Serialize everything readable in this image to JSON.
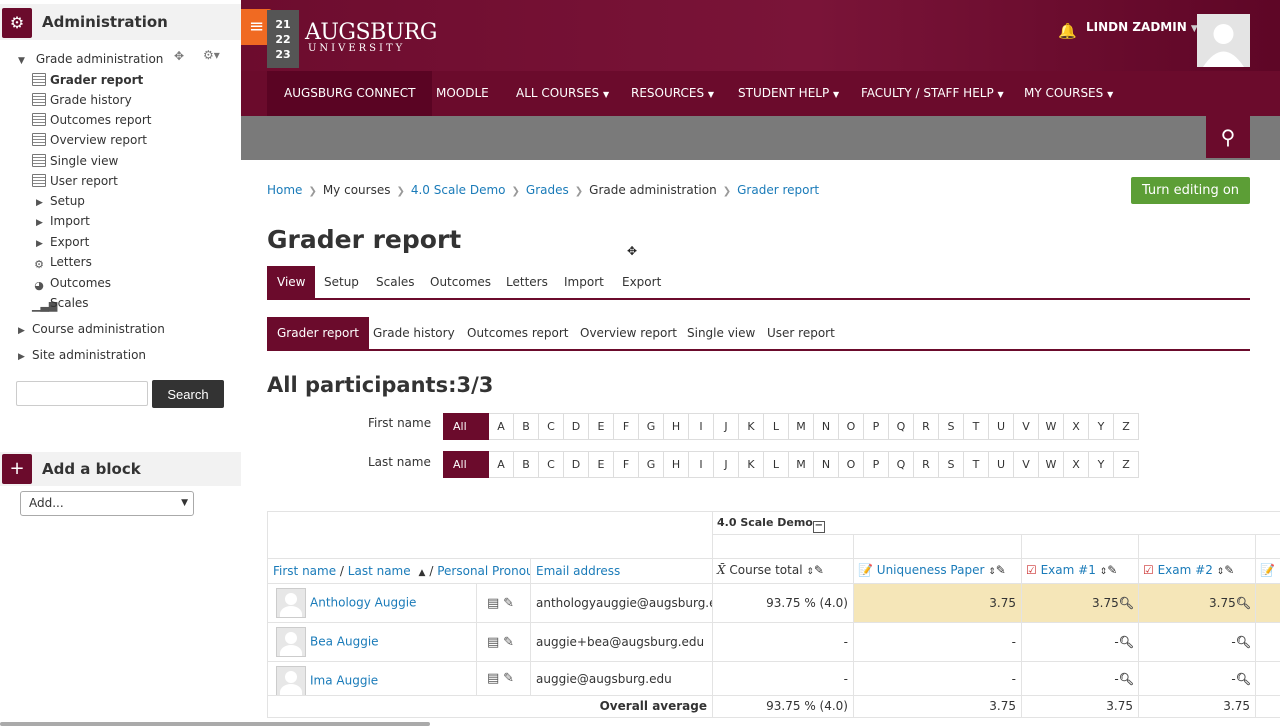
{
  "drawer": {
    "admin_title": "Administration",
    "grade_admin": "Grade administration",
    "items": [
      {
        "label": "Grader report",
        "bold": true
      },
      {
        "label": "Grade history"
      },
      {
        "label": "Outcomes report"
      },
      {
        "label": "Overview report"
      },
      {
        "label": "Single view"
      },
      {
        "label": "User report"
      },
      {
        "label": "Setup"
      },
      {
        "label": "Import"
      },
      {
        "label": "Export"
      },
      {
        "label": "Letters"
      },
      {
        "label": "Outcomes"
      },
      {
        "label": "Scales"
      }
    ],
    "course_admin": "Course administration",
    "site_admin": "Site administration",
    "search_button": "Search",
    "search_placeholder": "",
    "add_block_title": "Add a block",
    "add_select": "Add..."
  },
  "header": {
    "year_lines": [
      "21",
      "22",
      "23"
    ],
    "logo_main": "AUGSBURG",
    "logo_sub": "UNIVERSITY",
    "user": "LINDN ZADMIN",
    "nav": [
      "AUGSBURG CONNECT",
      "MOODLE",
      "ALL COURSES",
      "RESOURCES",
      "STUDENT HELP",
      "FACULTY / STAFF HELP",
      "MY COURSES"
    ],
    "brand_color": "#6b0b2c",
    "accent_color": "#f06a22"
  },
  "breadcrumb": [
    "Home",
    "My courses",
    "4.0 Scale Demo",
    "Grades",
    "Grade administration",
    "Grader report"
  ],
  "edit_button": "Turn editing on",
  "page_title": "Grader report",
  "tabs_top": [
    "View",
    "Setup",
    "Scales",
    "Outcomes",
    "Letters",
    "Import",
    "Export"
  ],
  "tabs_second": [
    "Grader report",
    "Grade history",
    "Outcomes report",
    "Overview report",
    "Single view",
    "User report"
  ],
  "participants": "All participants:3/3",
  "filter": {
    "first_label": "First name",
    "last_label": "Last name",
    "all": "All",
    "letters": [
      "A",
      "B",
      "C",
      "D",
      "E",
      "F",
      "G",
      "H",
      "I",
      "J",
      "K",
      "L",
      "M",
      "N",
      "O",
      "P",
      "Q",
      "R",
      "S",
      "T",
      "U",
      "V",
      "W",
      "X",
      "Y",
      "Z"
    ]
  },
  "table": {
    "course_label": "4.0 Scale Demo",
    "col_first": "First name",
    "col_slash": " / ",
    "col_last": "Last name",
    "col_pronouns": "Personal Pronouns",
    "col_email": "Email address",
    "col_total": "Course total",
    "col_paper": "Uniqueness Paper",
    "col_exam1": "Exam #1",
    "col_exam2": "Exam #2",
    "rows": [
      {
        "name": "Anthology Auggie",
        "email": "anthologyauggie@augsburg.edu",
        "total": "93.75 % (4.0)",
        "paper": "3.75",
        "exam1": "3.75",
        "exam2": "3.75"
      },
      {
        "name": "Bea Auggie",
        "email": "auggie+bea@augsburg.edu",
        "total": "-",
        "paper": "-",
        "exam1": "-",
        "exam2": "-"
      },
      {
        "name": "Ima Auggie",
        "email": "auggie@augsburg.edu",
        "total": "-",
        "paper": "-",
        "exam1": "-",
        "exam2": "-"
      }
    ],
    "avg_label": "Overall average",
    "avg_total": "93.75 % (4.0)",
    "avg_paper": "3.75",
    "avg_exam1": "3.75",
    "avg_exam2": "3.75"
  }
}
